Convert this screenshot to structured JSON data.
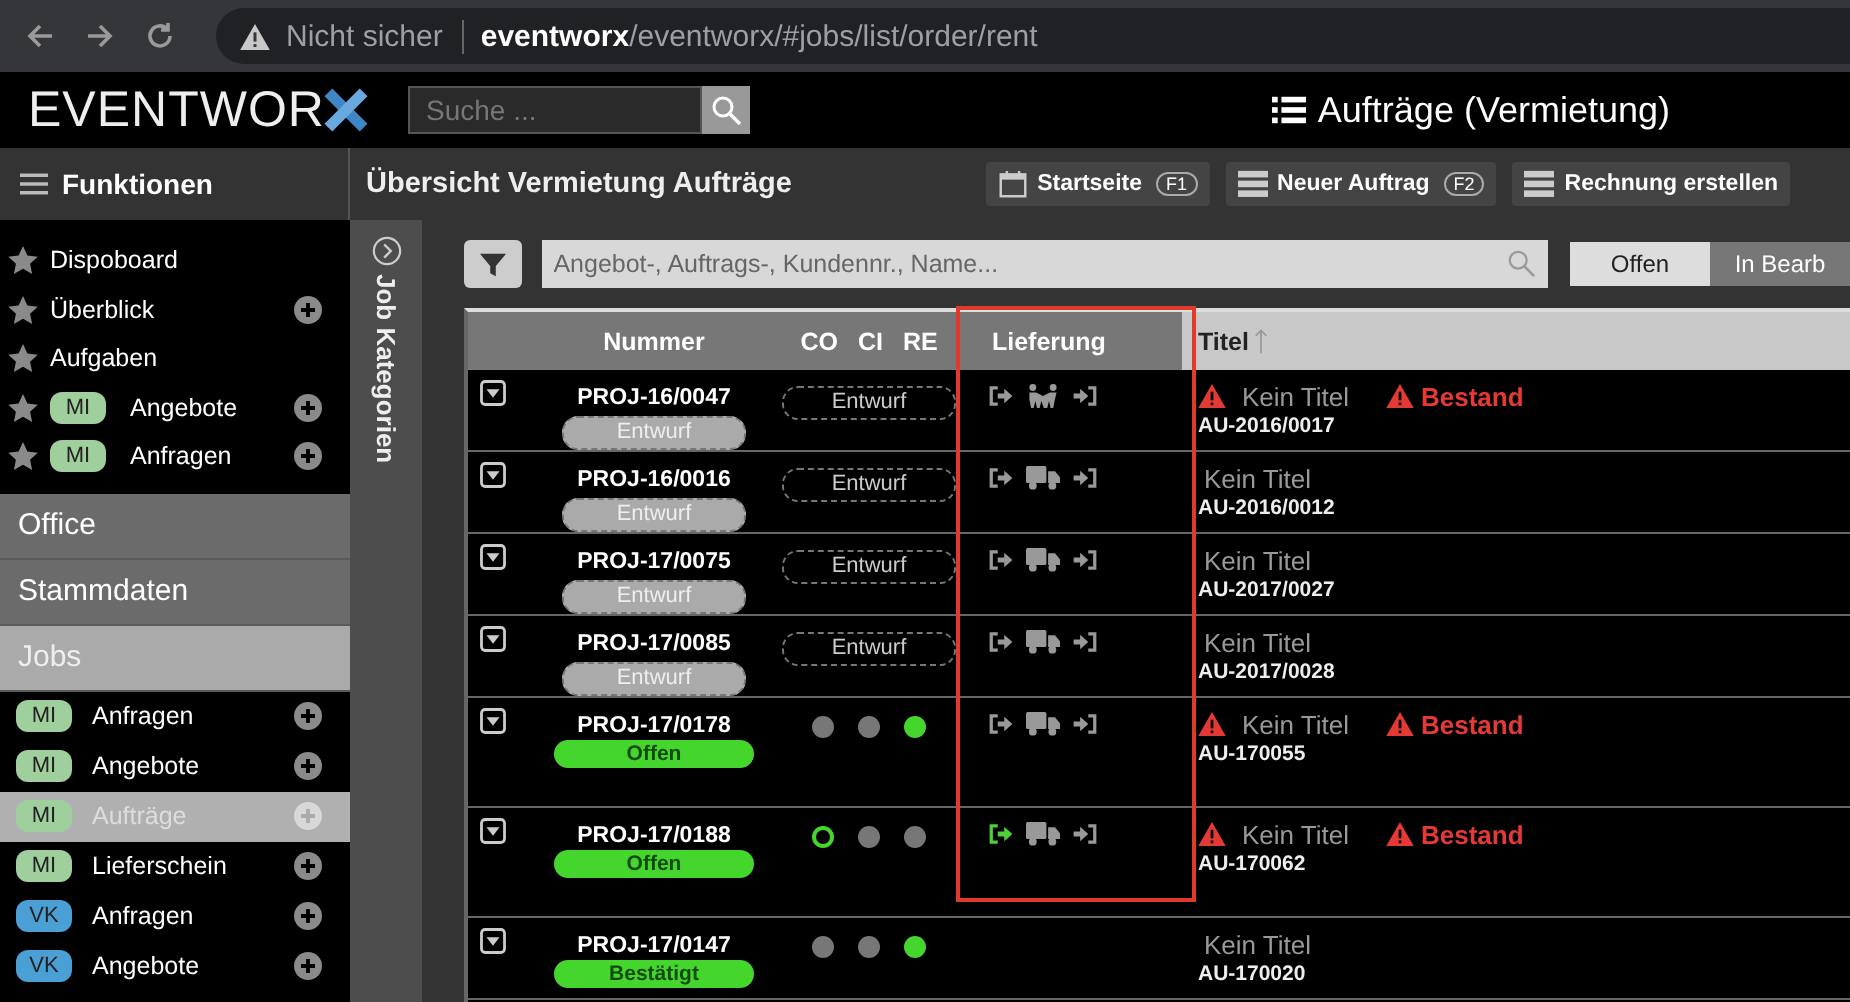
{
  "browser": {
    "security": "Nicht sicher",
    "url": "**eventworx**/eventworx/#jobs/list/order/rent"
  },
  "header": {
    "logo": "EVENTWOR",
    "search": {
      "placeholder": "Suche ..."
    },
    "title": "Aufträge (Vermietung)"
  },
  "sidebar": {
    "title": "Funktionen",
    "favorites": [
      {
        "label": "Dispoboard",
        "add": false
      },
      {
        "label": "Überblick",
        "add": true
      },
      {
        "label": "Aufgaben",
        "add": false
      },
      {
        "badge": "MI",
        "color": "#9fcf9c",
        "label": "Angebote",
        "add": true
      },
      {
        "badge": "MI",
        "color": "#9fcf9c",
        "label": "Anfragen",
        "add": true
      }
    ],
    "sections": [
      {
        "label": "Office",
        "selected": false
      },
      {
        "label": "Stammdaten",
        "selected": false
      },
      {
        "label": "Jobs",
        "selected": true
      }
    ],
    "items": [
      {
        "badge": "MI",
        "color": "#9fcf9c",
        "label": "Anfragen",
        "selected": false
      },
      {
        "badge": "MI",
        "color": "#9fcf9c",
        "label": "Angebote",
        "selected": false
      },
      {
        "badge": "MI",
        "color": "#9fcf9c",
        "label": "Aufträge",
        "selected": true
      },
      {
        "badge": "MI",
        "color": "#9fcf9c",
        "label": "Lieferschein",
        "selected": false
      },
      {
        "badge": "VK",
        "color": "#4a9fd4",
        "label": "Anfragen",
        "selected": false
      },
      {
        "badge": "VK",
        "color": "#4a9fd4",
        "label": "Angebote",
        "selected": false
      }
    ]
  },
  "categories_panel": {
    "label": "Job Kategorien"
  },
  "page": {
    "title": "Übersicht Vermietung Aufträge",
    "buttons": [
      {
        "label": "Startseite",
        "key": "F1"
      },
      {
        "label": "Neuer Auftrag",
        "key": "F2"
      },
      {
        "label": "Rechnung erstellen"
      }
    ]
  },
  "filter": {
    "placeholder": "Angebot-, Auftrags-, Kundennr., Name...",
    "tabs": [
      {
        "label": "Offen",
        "selected": true
      },
      {
        "label": "In Bearb",
        "selected": false
      }
    ]
  },
  "table": {
    "columns": [
      "Nummer",
      "CO",
      "CI",
      "RE",
      "Lieferung",
      "Titel"
    ],
    "rows": [
      {
        "number": "PROJ-16/0047",
        "status": {
          "label": "Entwurf",
          "kind": "draft"
        },
        "checks": {
          "kind": "draft",
          "label": "Entwurf"
        },
        "delivery": {
          "kind": "people",
          "out_active": false
        },
        "warning": true,
        "title": "Kein Titel",
        "stock": "Bestand",
        "code": "AU-2016/0017"
      },
      {
        "number": "PROJ-16/0016",
        "status": {
          "label": "Entwurf",
          "kind": "draft"
        },
        "checks": {
          "kind": "draft",
          "label": "Entwurf"
        },
        "delivery": {
          "kind": "truck",
          "out_active": false
        },
        "warning": false,
        "title": "Kein Titel",
        "code": "AU-2016/0012"
      },
      {
        "number": "PROJ-17/0075",
        "status": {
          "label": "Entwurf",
          "kind": "draft"
        },
        "checks": {
          "kind": "draft",
          "label": "Entwurf"
        },
        "delivery": {
          "kind": "truck",
          "out_active": false
        },
        "warning": false,
        "title": "Kein Titel",
        "code": "AU-2017/0027"
      },
      {
        "number": "PROJ-17/0085",
        "status": {
          "label": "Entwurf",
          "kind": "draft"
        },
        "checks": {
          "kind": "draft",
          "label": "Entwurf"
        },
        "delivery": {
          "kind": "truck",
          "out_active": false
        },
        "warning": false,
        "title": "Kein Titel",
        "code": "AU-2017/0028"
      },
      {
        "number": "PROJ-17/0178",
        "status": {
          "label": "Offen",
          "kind": "open"
        },
        "checks": {
          "kind": "dots",
          "dots": [
            {
              "kind": "off"
            },
            {
              "kind": "off"
            },
            {
              "kind": "done"
            }
          ]
        },
        "delivery": {
          "kind": "truck",
          "out_active": false
        },
        "warning": true,
        "title": "Kein Titel",
        "stock": "Bestand",
        "code": "AU-170055"
      },
      {
        "number": "PROJ-17/0188",
        "status": {
          "label": "Offen",
          "kind": "open"
        },
        "checks": {
          "kind": "dots",
          "dots": [
            {
              "kind": "started"
            },
            {
              "kind": "off"
            },
            {
              "kind": "off"
            }
          ]
        },
        "delivery": {
          "kind": "truck",
          "out_active": true
        },
        "warning": true,
        "title": "Kein Titel",
        "stock": "Bestand",
        "code": "AU-170062"
      },
      {
        "number": "PROJ-17/0147",
        "status": {
          "label": "Bestätigt",
          "kind": "confirmed"
        },
        "checks": {
          "kind": "dots",
          "dots": [
            {
              "kind": "off"
            },
            {
              "kind": "off"
            },
            {
              "kind": "done"
            }
          ]
        },
        "warning": false,
        "title": "Kein Titel",
        "code": "AU-170020"
      }
    ]
  }
}
